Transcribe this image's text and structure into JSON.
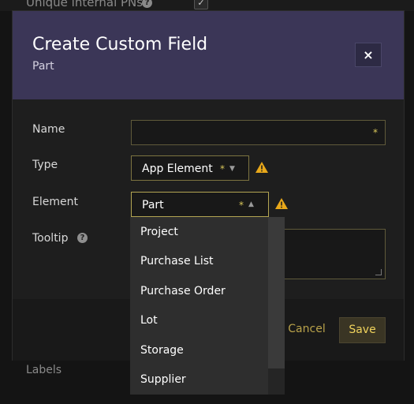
{
  "background": {
    "top_label": "Unique internal PNs",
    "checkbox_checked": true,
    "labels_text": "Labels"
  },
  "modal": {
    "title": "Create Custom Field",
    "subtitle": "Part",
    "close_symbol": "×",
    "fields": {
      "name": {
        "label": "Name",
        "value": "",
        "required_marker": "*"
      },
      "type": {
        "label": "Type",
        "value": "App Element",
        "required_marker": "*"
      },
      "element": {
        "label": "Element",
        "value": "Part",
        "required_marker": "*"
      },
      "tooltip": {
        "label": "Tooltip",
        "value": ""
      }
    },
    "buttons": {
      "cancel": "Cancel",
      "save": "Save"
    }
  },
  "dropdown": {
    "options": [
      "Project",
      "Purchase List",
      "Purchase Order",
      "Lot",
      "Storage",
      "Supplier"
    ]
  },
  "colors": {
    "header_bg": "#3b3657",
    "accent": "#d9c75a",
    "warning": "#e8a81a"
  }
}
